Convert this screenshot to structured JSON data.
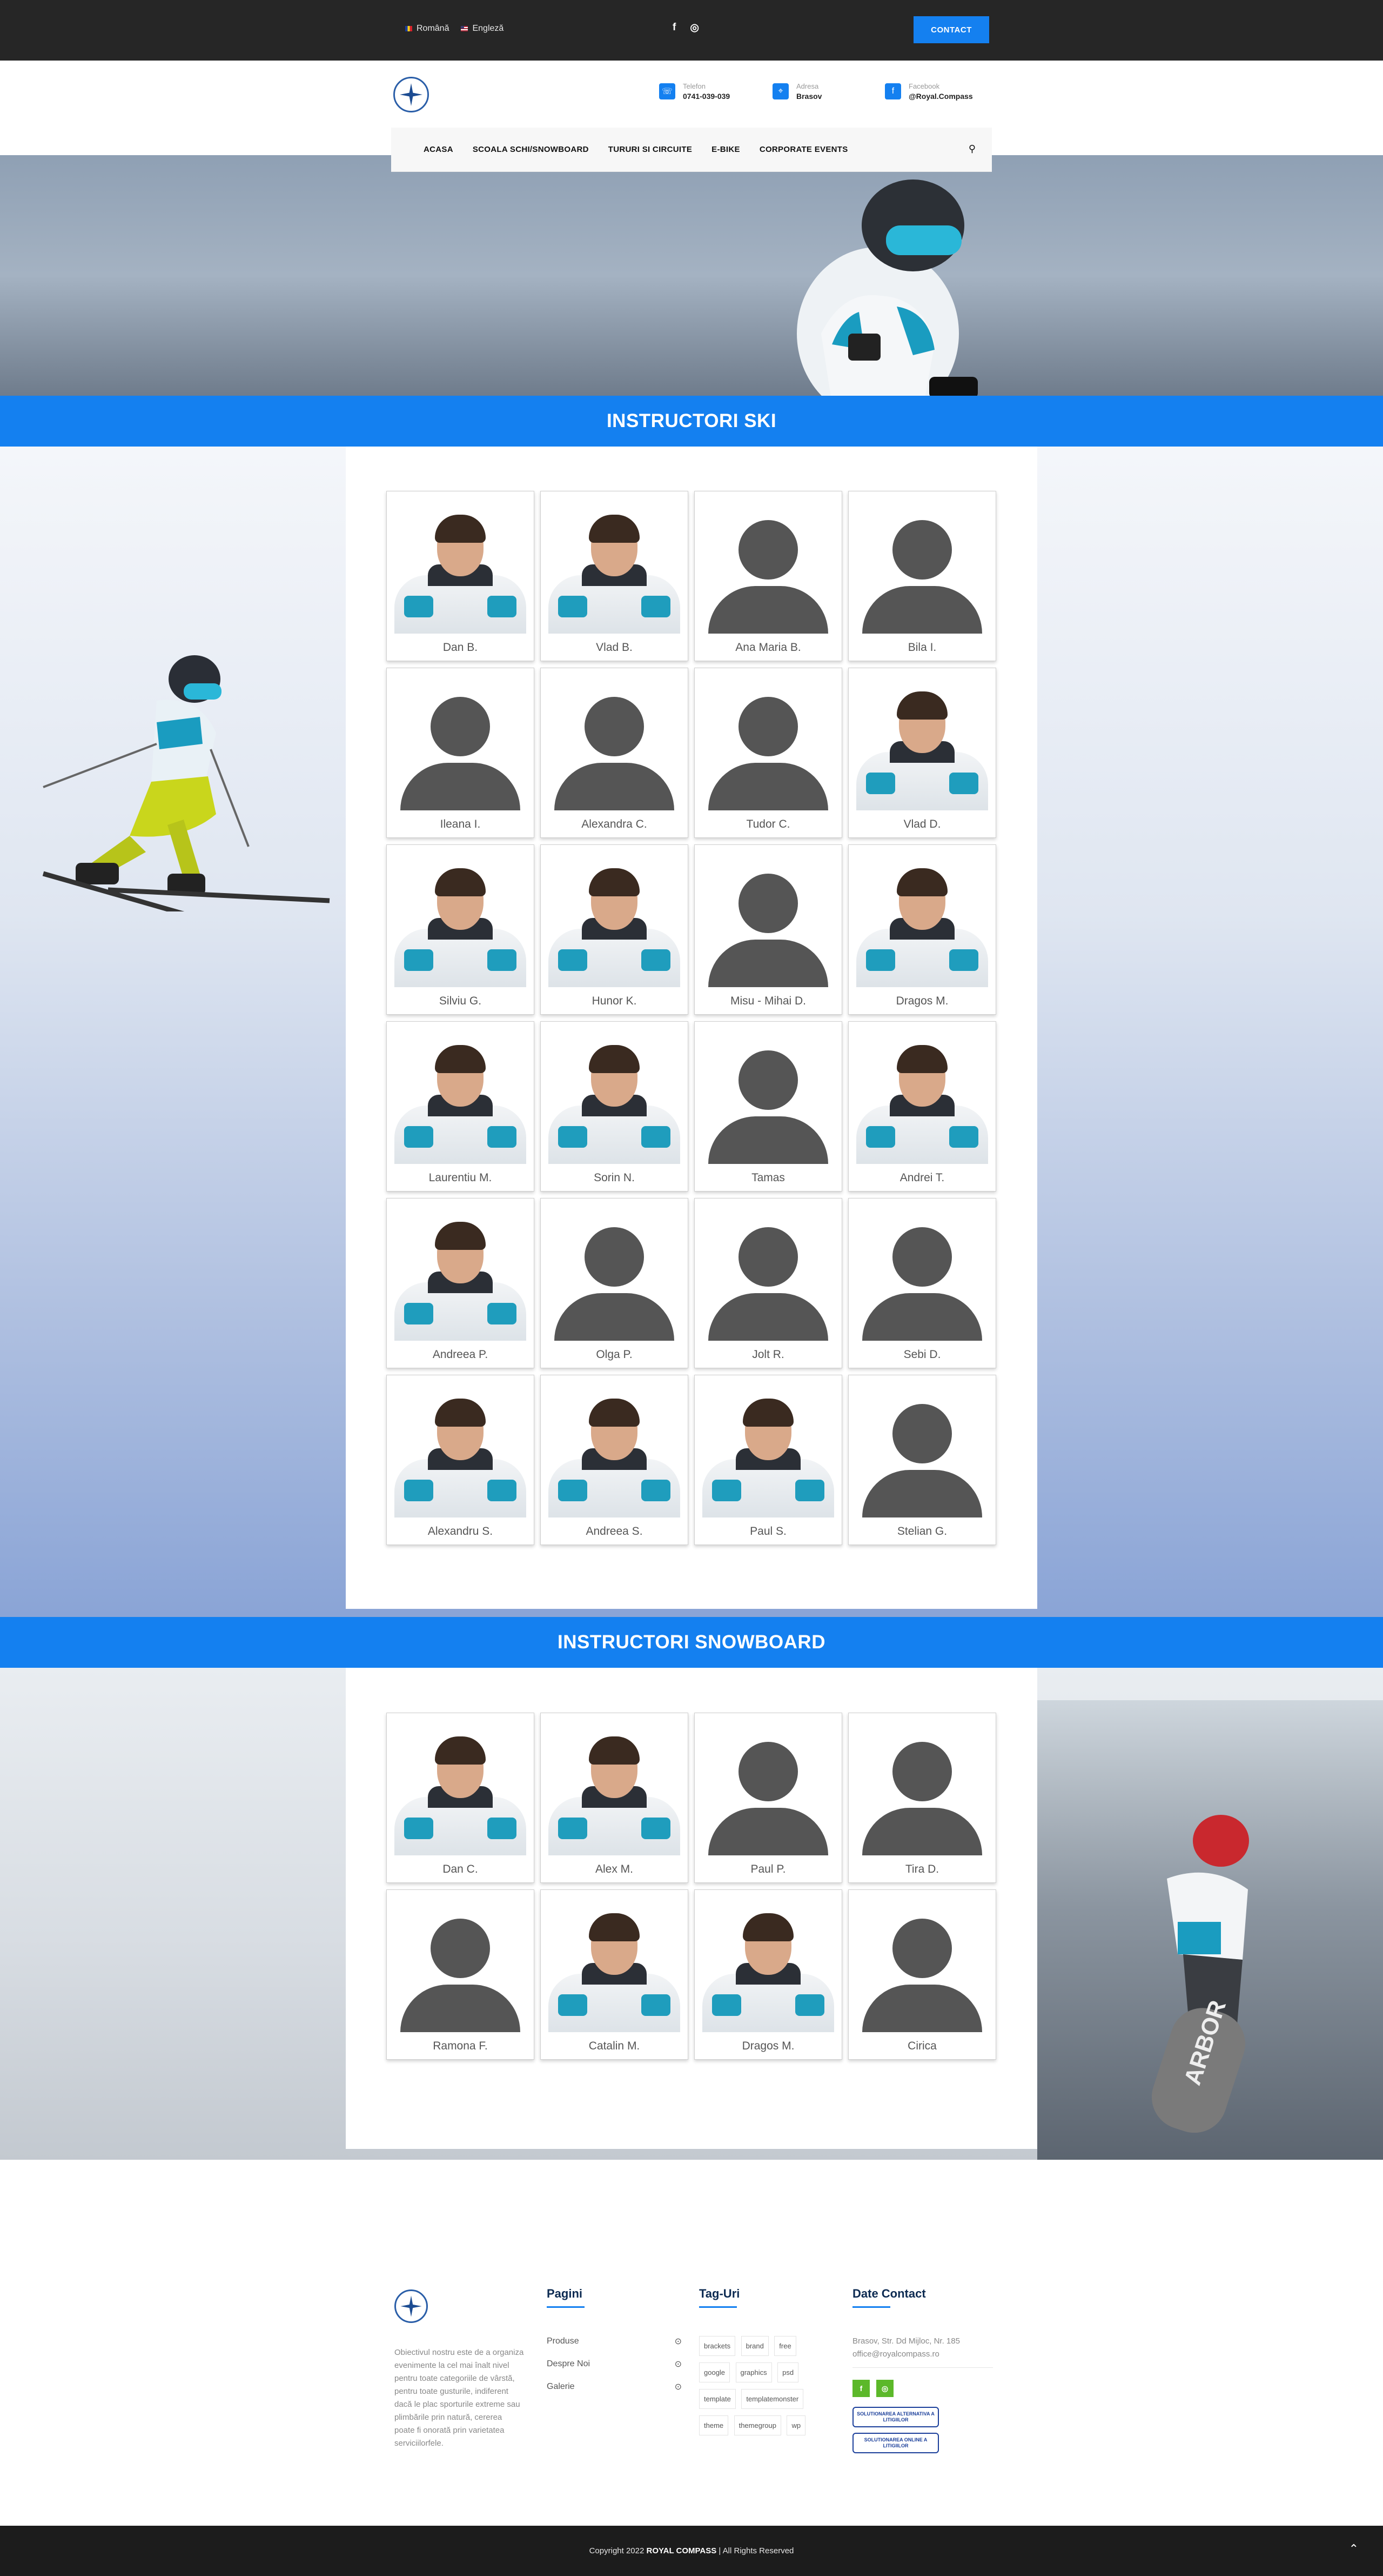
{
  "topbar": {
    "languages": [
      {
        "label": "Română",
        "flag": "ro"
      },
      {
        "label": "Engleză",
        "flag": "en"
      }
    ],
    "social": [
      "f",
      "◎"
    ],
    "contact_label": "CONTACT",
    "bg_color": "#262626",
    "accent_color": "#1480f0"
  },
  "header": {
    "info": [
      {
        "label": "Telefon",
        "value": "0741-039-039",
        "icon": "phone-icon"
      },
      {
        "label": "Adresa",
        "value": "Brasov",
        "icon": "location-pin-icon"
      },
      {
        "label": "Facebook",
        "value": "@Royal.Compass",
        "icon": "facebook-icon"
      }
    ]
  },
  "nav": {
    "items": [
      "ACASA",
      "SCOALA SCHI/SNOWBOARD",
      "TURURI SI CIRCUITE",
      "E-BIKE",
      "CORPORATE EVENTS"
    ],
    "search_icon": "search-icon"
  },
  "sections": {
    "ski_title": "INSTRUCTORI SKI",
    "snowboard_title": "INSTRUCTORI SNOWBOARD"
  },
  "ski_instructors": [
    {
      "name": "Dan B.",
      "photo": true
    },
    {
      "name": "Vlad B.",
      "photo": true
    },
    {
      "name": "Ana Maria B.",
      "photo": false
    },
    {
      "name": "Bila I.",
      "photo": false
    },
    {
      "name": "Ileana I.",
      "photo": false
    },
    {
      "name": "Alexandra C.",
      "photo": false
    },
    {
      "name": "Tudor C.",
      "photo": false
    },
    {
      "name": "Vlad D.",
      "photo": true
    },
    {
      "name": "Silviu G.",
      "photo": true
    },
    {
      "name": "Hunor K.",
      "photo": true
    },
    {
      "name": "Misu - Mihai D.",
      "photo": false
    },
    {
      "name": "Dragos M.",
      "photo": true
    },
    {
      "name": "Laurentiu M.",
      "photo": true
    },
    {
      "name": "Sorin N.",
      "photo": true
    },
    {
      "name": "Tamas",
      "photo": false
    },
    {
      "name": "Andrei T.",
      "photo": true
    },
    {
      "name": "Andreea P.",
      "photo": true
    },
    {
      "name": "Olga P.",
      "photo": false
    },
    {
      "name": "Jolt R.",
      "photo": false
    },
    {
      "name": "Sebi D.",
      "photo": false
    },
    {
      "name": "Alexandru S.",
      "photo": true
    },
    {
      "name": "Andreea S.",
      "photo": true
    },
    {
      "name": "Paul S.",
      "photo": true
    },
    {
      "name": "Stelian G.",
      "photo": false
    }
  ],
  "snowboard_instructors": [
    {
      "name": "Dan C.",
      "photo": true
    },
    {
      "name": "Alex M.",
      "photo": true
    },
    {
      "name": "Paul P.",
      "photo": false
    },
    {
      "name": "Tira D.",
      "photo": false
    },
    {
      "name": "Ramona F.",
      "photo": false
    },
    {
      "name": "Catalin M.",
      "photo": true
    },
    {
      "name": "Dragos M.",
      "photo": true
    },
    {
      "name": "Cirica",
      "photo": false
    }
  ],
  "footer": {
    "about": "Obiectivul nostru este de a organiza evenimente la cel mai înalt nivel pentru toate categoriile de vârstă, pentru toate gusturile, indiferent dacă le plac sporturile extreme sau plimbările prin natură, cererea poate fi onorată prin varietatea serviciilorfele.",
    "pages_title": "Pagini",
    "pages": [
      "Produse",
      "Despre Noi",
      "Galerie"
    ],
    "tags_title": "Tag-Uri",
    "tags": [
      "brackets",
      "brand",
      "free",
      "google",
      "graphics",
      "psd",
      "template",
      "templatemonster",
      "theme",
      "themegroup",
      "wp"
    ],
    "contact_title": "Date Contact",
    "address": "Brasov, Str. Dd Mijloc, Nr. 185",
    "email": "office@royalcompass.ro",
    "badges": [
      "SOLUTIONAREA ALTERNATIVA A LITIGIILOR",
      "SOLUTIONAREA ONLINE A LITIGIILOR"
    ],
    "copyright_prefix": "Copyright 2022",
    "brand": "ROYAL COMPASS",
    "copyright_suffix": "| All Rights Reserved"
  }
}
